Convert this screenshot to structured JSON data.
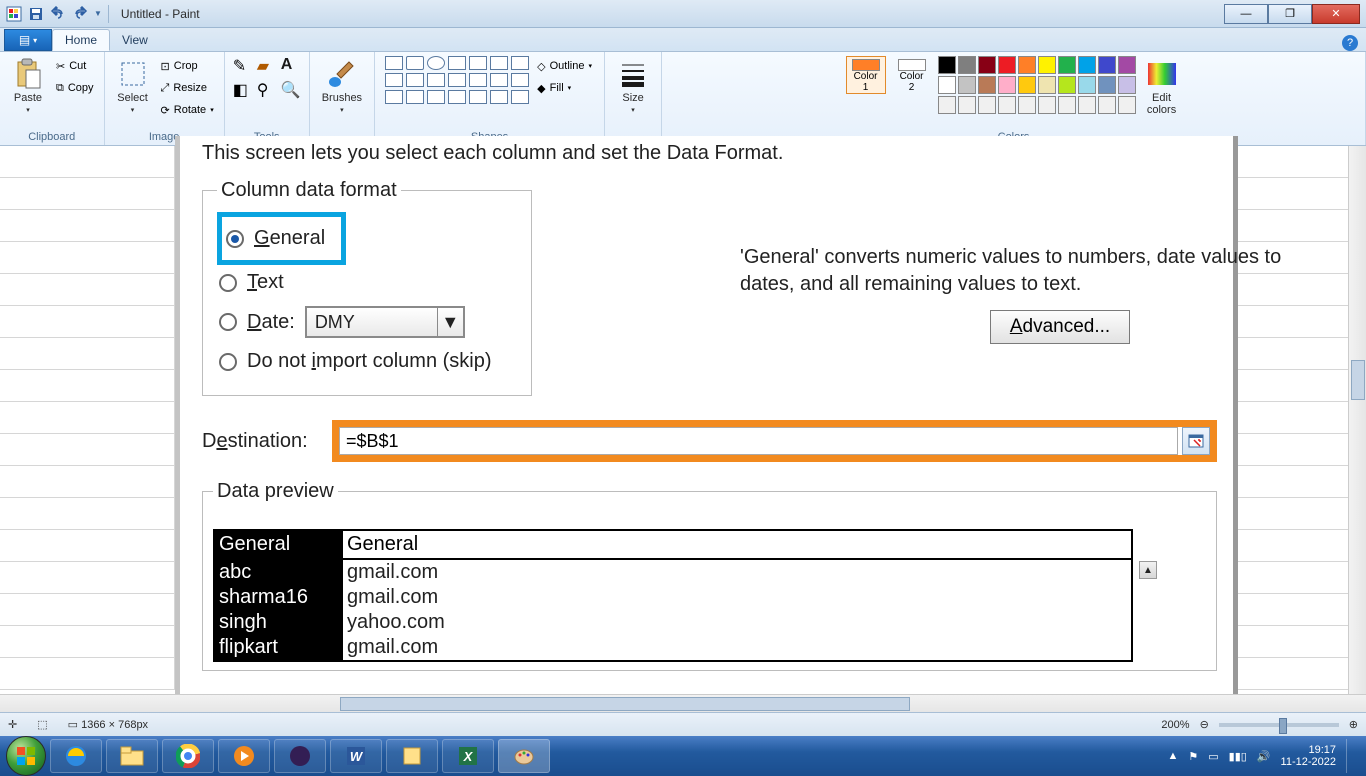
{
  "titlebar": {
    "title": "Untitled - Paint"
  },
  "tabs": {
    "home": "Home",
    "view": "View"
  },
  "ribbon": {
    "clipboard": {
      "label": "Clipboard",
      "paste": "Paste",
      "cut": "Cut",
      "copy": "Copy"
    },
    "image": {
      "label": "Image",
      "select": "Select",
      "crop": "Crop",
      "resize": "Resize",
      "rotate": "Rotate"
    },
    "tools": {
      "label": "Tools"
    },
    "brushes": {
      "label": "Brushes"
    },
    "shapes": {
      "label": "Shapes",
      "outline": "Outline",
      "fill": "Fill"
    },
    "size": {
      "label": "Size"
    },
    "colors": {
      "label": "Colors",
      "color1": "Color\n1",
      "color2": "Color\n2",
      "edit": "Edit\ncolors"
    },
    "palette": [
      "#000000",
      "#7f7f7f",
      "#880015",
      "#ed1c24",
      "#ff7f27",
      "#fff200",
      "#22b14c",
      "#00a2e8",
      "#3f48cc",
      "#a349a4",
      "#ffffff",
      "#c3c3c3",
      "#b97a57",
      "#ffaec9",
      "#ffc90e",
      "#efe4b0",
      "#b5e61d",
      "#99d9ea",
      "#7092be",
      "#c8bfe7",
      "#f0f0f0",
      "#f0f0f0",
      "#f0f0f0",
      "#f0f0f0",
      "#f0f0f0",
      "#f0f0f0",
      "#f0f0f0",
      "#f0f0f0",
      "#f0f0f0",
      "#f0f0f0"
    ],
    "accent": "#ff7f27"
  },
  "dialog": {
    "instruction": "This screen lets you select each column and set the Data Format.",
    "column_format_legend": "Column data format",
    "general": "General",
    "text": "Text",
    "date": "Date:",
    "date_value": "DMY",
    "skip": "Do not import column (skip)",
    "info": "'General' converts numeric values to numbers, date values to dates, and all remaining values to text.",
    "advanced": "Advanced...",
    "destination_label": "Destination:",
    "destination_value": "=$B$1",
    "preview_legend": "Data preview",
    "preview_headers": [
      "General",
      "General"
    ],
    "preview_rows": [
      [
        "abc",
        "gmail.com"
      ],
      [
        "sharma16",
        "gmail.com"
      ],
      [
        "singh",
        "yahoo.com"
      ],
      [
        "flipkart",
        "gmail.com"
      ]
    ]
  },
  "status": {
    "dims": "1366 × 768px",
    "zoom": "200%"
  },
  "tray": {
    "time": "19:17",
    "date": "11-12-2022"
  }
}
